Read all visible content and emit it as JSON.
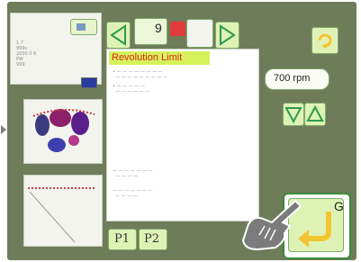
{
  "header": {
    "page_number": "9",
    "indicator_color": "#e23b3b"
  },
  "dialog": {
    "title": "Revolution Limit",
    "title_bg": "#d6f25a",
    "title_color": "#e02020"
  },
  "speed": {
    "value_label": "700 rpm"
  },
  "tabs": {
    "p1_label": "P1",
    "p2_label": "P2"
  },
  "go_button": {
    "label": "G"
  },
  "colors": {
    "screen_bg": "#6f7c5a",
    "button_bg": "#dff2b6",
    "arrow_green": "#2e9a4e",
    "enter_arrow": "#f3c530"
  },
  "icons": {
    "back": "left-arrow-icon",
    "forward": "right-arrow-icon",
    "increase": "triangle-up-icon",
    "decrease": "triangle-down-icon",
    "enter": "enter-arrow-icon",
    "hand": "pointing-hand-icon",
    "sync": "circular-arrows-icon"
  }
}
